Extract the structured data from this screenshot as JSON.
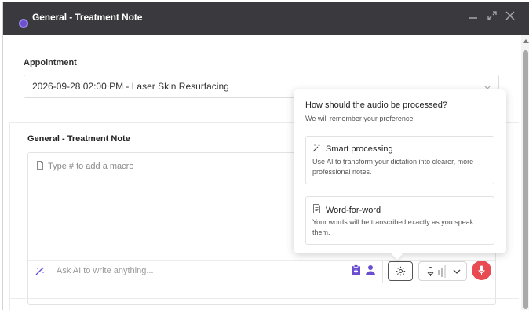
{
  "window": {
    "title": "General - Treatment Note"
  },
  "appointment": {
    "label": "Appointment",
    "selected": "2026-09-28 02:00 PM - Laser Skin Resurfacing"
  },
  "note": {
    "label": "General - Treatment Note",
    "editor_placeholder": "Type # to add a macro",
    "ai_placeholder": "Ask AI to write anything..."
  },
  "audio_popover": {
    "title": "How should the audio be processed?",
    "subtitle": "We will remember your preference",
    "options": [
      {
        "label": "Smart processing",
        "description": "Use AI to transform your dictation into clearer, more professional notes.",
        "icon": "magic-wand-icon"
      },
      {
        "label": "Word-for-word",
        "description": "Your words will be transcribed exactly as you speak them.",
        "icon": "document-icon"
      }
    ]
  },
  "colors": {
    "titlebar": "#3a3a3e",
    "accent": "#6b4fd0",
    "record": "#e84b52"
  }
}
